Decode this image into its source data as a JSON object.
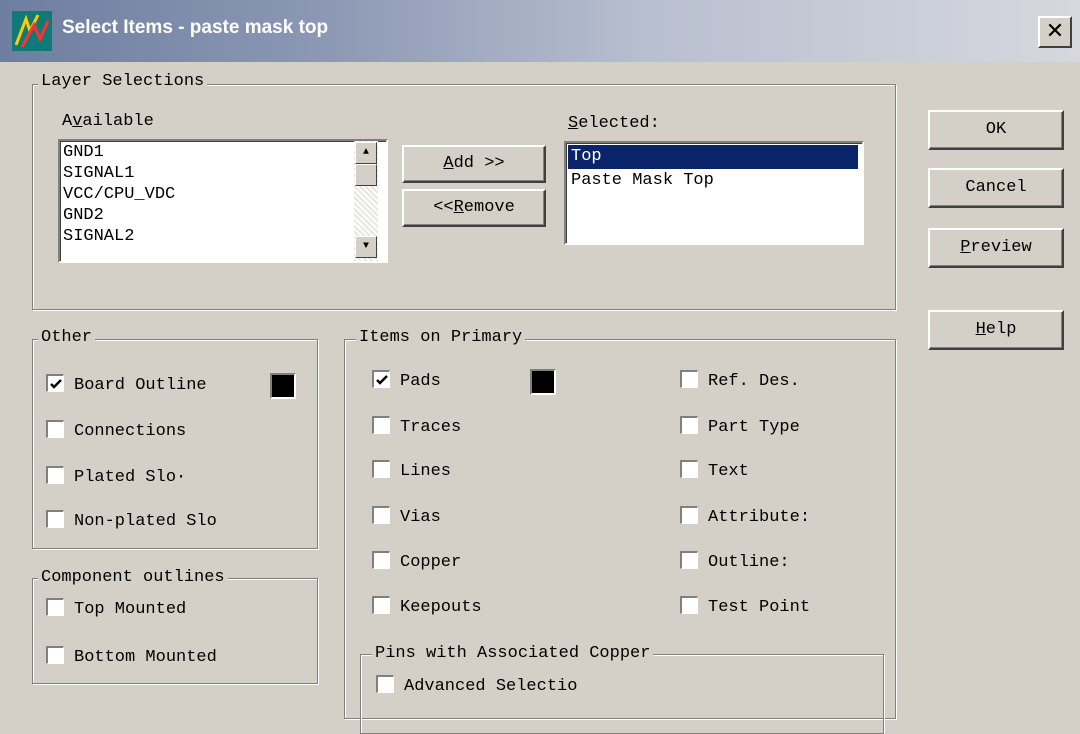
{
  "window": {
    "title": "Select Items - paste mask top"
  },
  "layer_selections": {
    "group_label": "Layer Selections",
    "available_label_pre": "A",
    "available_label_key": "v",
    "available_label_post": "ailable",
    "available": [
      "GND1",
      "SIGNAL1",
      "VCC/CPU_VDC",
      "GND2",
      "SIGNAL2"
    ],
    "add_pre": "",
    "add_key": "A",
    "add_post": "dd >>",
    "remove_pre": "<<",
    "remove_key": "R",
    "remove_post": "emove",
    "selected_label_key": "S",
    "selected_label_post": "elected:",
    "selected": [
      "Top",
      "Paste Mask Top"
    ]
  },
  "buttons": {
    "ok": "OK",
    "cancel": "Cancel",
    "preview_key": "P",
    "preview_post": "review",
    "help_key": "H",
    "help_post": "elp"
  },
  "other": {
    "group_label": "Other",
    "items": [
      {
        "label": "Board Outline",
        "checked": true
      },
      {
        "label": "Connections",
        "checked": false
      },
      {
        "label": "Plated Slo·",
        "checked": false
      },
      {
        "label": "Non-plated Slo",
        "checked": false
      }
    ],
    "swatch_color": "#000000"
  },
  "component_outlines": {
    "group_label": "Component outlines",
    "items": [
      {
        "label": "Top Mounted",
        "checked": false
      },
      {
        "label": "Bottom Mounted",
        "checked": false
      }
    ]
  },
  "items_on_primary": {
    "group_label": "Items on Primary",
    "left": [
      {
        "label": "Pads",
        "checked": true
      },
      {
        "label": "Traces",
        "checked": false
      },
      {
        "label": "Lines",
        "checked": false
      },
      {
        "label": "Vias",
        "checked": false
      },
      {
        "label": "Copper",
        "checked": false
      },
      {
        "label": "Keepouts",
        "checked": false
      }
    ],
    "right": [
      {
        "label": "Ref. Des.",
        "checked": false
      },
      {
        "label": "Part Type",
        "checked": false
      },
      {
        "label": "Text",
        "checked": false
      },
      {
        "label": "Attribute:",
        "checked": false
      },
      {
        "label": "Outline:",
        "checked": false
      },
      {
        "label": "Test Point",
        "checked": false
      }
    ],
    "swatch_color": "#000000"
  },
  "pins_with_copper": {
    "group_label": "Pins with Associated Copper",
    "items": [
      {
        "label": "Advanced Selectio",
        "checked": false
      }
    ]
  },
  "colors": {
    "title_start": "#6e7ea0",
    "selection": "#0a246a",
    "face": "#d4d0c8",
    "icon_bg": "#0f7a78"
  }
}
